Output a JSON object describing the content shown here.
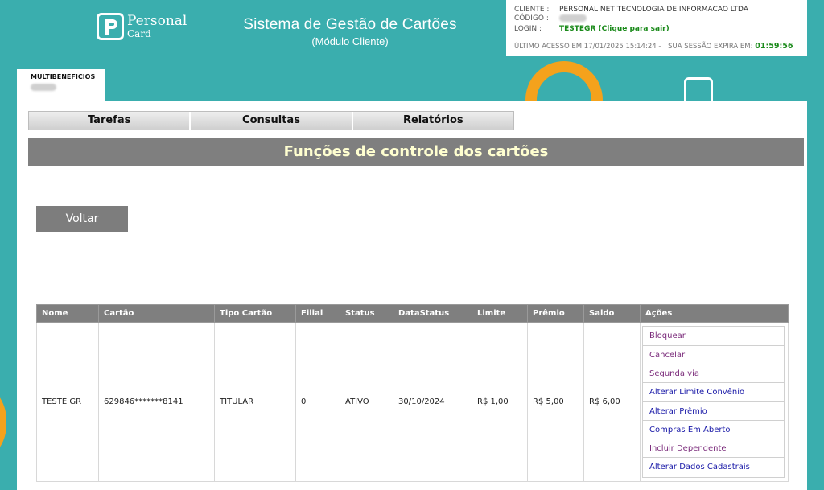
{
  "header": {
    "logo_line1": "Personal",
    "logo_line2": "Card",
    "title": "Sistema de Gestão de Cartões",
    "subtitle": "(Módulo Cliente)"
  },
  "session": {
    "cliente_label": "CLIENTE :",
    "cliente_value": "PERSONAL NET TECNOLOGIA DE INFORMACAO LTDA",
    "codigo_label": "CÓDIGO :",
    "login_label": "LOGIN :",
    "login_value": "TESTEGR (Clique para sair)",
    "last_access": "ÚLTIMO ACESSO EM 17/01/2025 15:14:24 -",
    "expires_label": "SUA SESSÃO EXPIRA EM:",
    "expires_value": "01:59:56"
  },
  "tab": {
    "label": "MULTIBENEFICIOS"
  },
  "menu": [
    {
      "label": "Tarefas"
    },
    {
      "label": "Consultas"
    },
    {
      "label": "Relatórios"
    }
  ],
  "section_title": "Funções de controle dos cartões",
  "back_button": "Voltar",
  "table": {
    "headers": [
      "Nome",
      "Cartão",
      "Tipo Cartão",
      "Filial",
      "Status",
      "DataStatus",
      "Limite",
      "Prêmio",
      "Saldo",
      "Ações"
    ],
    "rows": [
      {
        "cells": [
          "TESTE GR",
          "629846*******8141",
          "TITULAR",
          "0",
          "ATIVO",
          "30/10/2024",
          "R$ 1,00",
          "R$ 5,00",
          "R$ 6,00"
        ],
        "actions": [
          {
            "label": "Bloquear",
            "color": "#7a2a7a"
          },
          {
            "label": "Cancelar",
            "color": "#7a2a7a"
          },
          {
            "label": "Segunda via",
            "color": "#7a2a7a"
          },
          {
            "label": "Alterar Limite Convênio",
            "color": "#1a1aa8"
          },
          {
            "label": "Alterar Prêmio",
            "color": "#1a1aa8"
          },
          {
            "label": "Compras Em Aberto",
            "color": "#1a1aa8"
          },
          {
            "label": "Incluir Dependente",
            "color": "#7a2a7a"
          },
          {
            "label": "Alterar Dados Cadastrais",
            "color": "#1a1aa8"
          }
        ]
      }
    ]
  },
  "colors": {
    "background": "#3aaeae",
    "accent_orange": "#f4a21c",
    "header_gray": "#7f7f7f",
    "timer_green": "#1a8a1a"
  }
}
